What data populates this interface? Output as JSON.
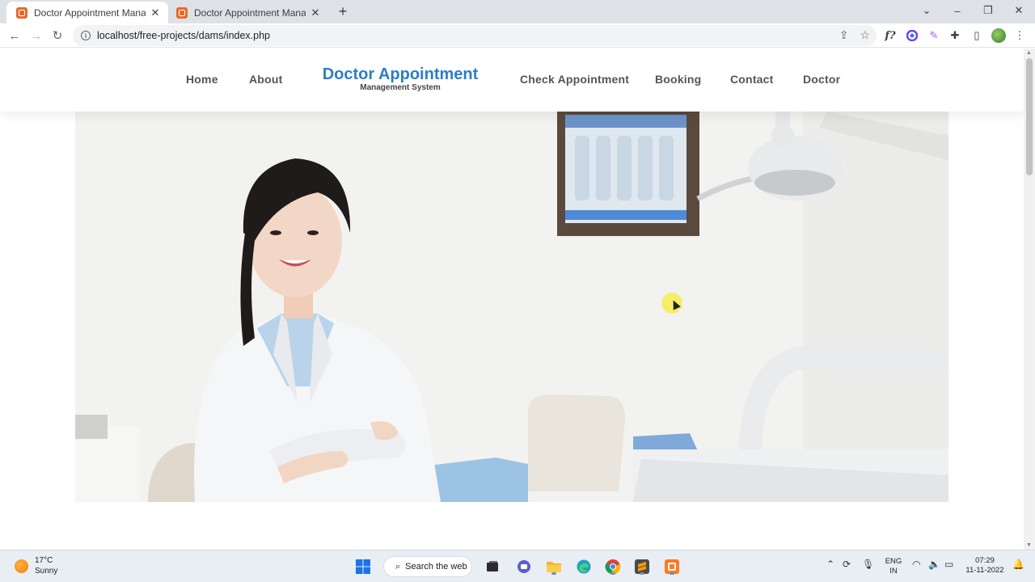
{
  "browser": {
    "tabs": [
      {
        "title": "Doctor Appointment Manageme",
        "active": true
      },
      {
        "title": "Doctor Appointment Manageme",
        "active": false
      }
    ],
    "new_tab_glyph": "+",
    "url": "localhost/free-projects/dams/index.php",
    "extension_glyph": "f?"
  },
  "site": {
    "nav_left": [
      "Home",
      "About"
    ],
    "brand": {
      "title": "Doctor Appointment",
      "subtitle": "Management System"
    },
    "nav_right": [
      "Check Appointment",
      "Booking",
      "Contact",
      "Doctor"
    ]
  },
  "taskbar": {
    "weather": {
      "temp": "17°C",
      "condition": "Sunny"
    },
    "search_label": "Search the web",
    "language": {
      "line1": "ENG",
      "line2": "IN"
    },
    "clock": {
      "time": "07:29",
      "date": "11-11-2022"
    }
  },
  "colors": {
    "brand": "#2f7dc8",
    "nav_text": "#555555",
    "tab_strip": "#dee1e6",
    "taskbar": "#e9eef5"
  },
  "icons": {
    "tab_favicon": "xampp-favicon",
    "toolbar": [
      "back-arrow-icon",
      "forward-arrow-icon",
      "reload-icon"
    ],
    "omnibox": [
      "site-info-icon",
      "share-icon",
      "star-icon"
    ],
    "extensions": [
      "font-icon",
      "color-circle-icon",
      "pen-icon",
      "puzzle-icon",
      "sidebar-icon",
      "profile-avatar-icon",
      "menu-dots-icon"
    ],
    "taskbar_apps": [
      "windows-start-icon",
      "search-icon",
      "task-view-icon",
      "teams-chat-icon",
      "file-explorer-icon",
      "edge-icon",
      "chrome-icon",
      "sublime-text-icon",
      "xampp-icon"
    ]
  }
}
